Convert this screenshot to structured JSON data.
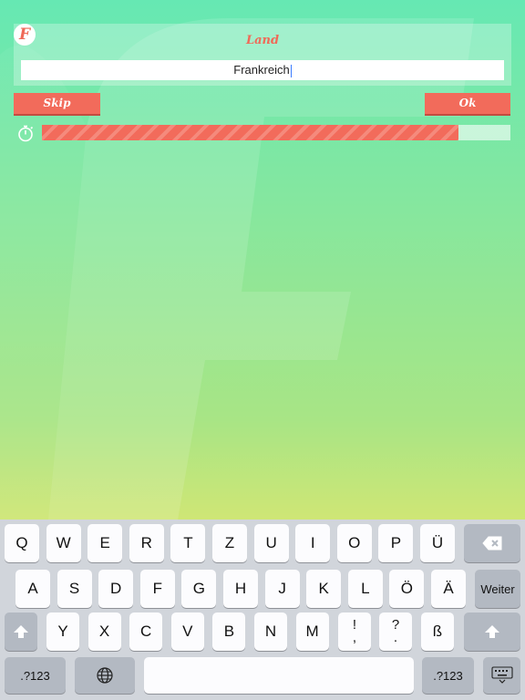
{
  "app": {
    "logo_letter": "F"
  },
  "question": {
    "category": "Land",
    "answer": "Frankreich"
  },
  "buttons": {
    "skip": "Skip",
    "ok": "Ok"
  },
  "timer": {
    "icon": "stopwatch-icon",
    "progress": 0.89
  },
  "keyboard": {
    "row1": [
      "Q",
      "W",
      "E",
      "R",
      "T",
      "Z",
      "U",
      "I",
      "O",
      "P",
      "Ü"
    ],
    "row2": [
      "A",
      "S",
      "D",
      "F",
      "G",
      "H",
      "J",
      "K",
      "L",
      "Ö",
      "Ä"
    ],
    "row3": [
      "Y",
      "X",
      "C",
      "V",
      "B",
      "N",
      "M"
    ],
    "punct1": {
      "top": "!",
      "bottom": ","
    },
    "punct2": {
      "top": "?",
      "bottom": "."
    },
    "sz": "ß",
    "return_label": "Weiter",
    "numbers_label": ".?123",
    "icons": [
      "backspace-icon",
      "shift-icon",
      "globe-icon",
      "keyboard-dismiss-icon"
    ]
  },
  "colors": {
    "accent": "#f26b5b",
    "bg_top": "#66e8b3",
    "bg_bottom": "#e0e77a"
  }
}
